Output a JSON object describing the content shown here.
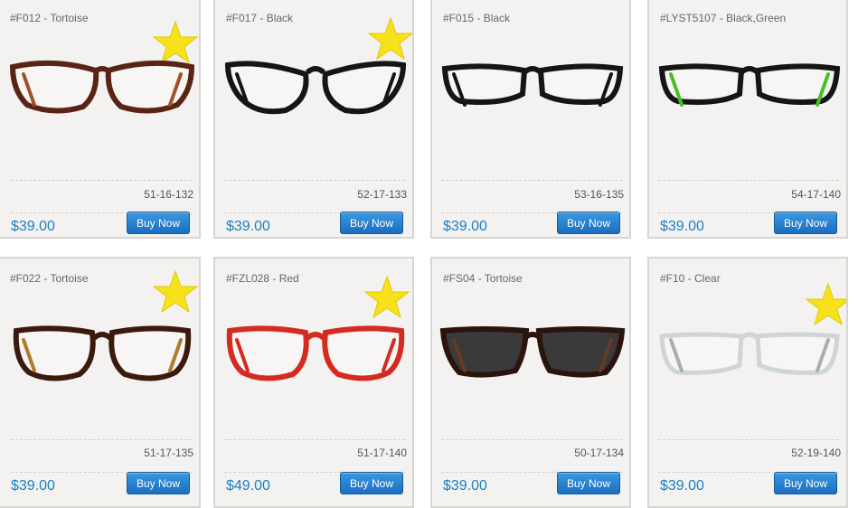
{
  "products": [
    {
      "title": "#F012 - Tortoise",
      "size": "51-16-132",
      "price": "$39.00",
      "buy_label": "Buy Now",
      "featured": true,
      "frame_color": "#5a2414",
      "frame_accent": "#a0502a",
      "lens_color": "none",
      "style": "cat-eye"
    },
    {
      "title": "#F017 - Black",
      "size": "52-17-133",
      "price": "$39.00",
      "buy_label": "Buy Now",
      "featured": true,
      "frame_color": "#151515",
      "frame_accent": "#151515",
      "lens_color": "none",
      "style": "cat-eye-round"
    },
    {
      "title": "#F015 - Black",
      "size": "53-16-135",
      "price": "$39.00",
      "buy_label": "Buy Now",
      "featured": false,
      "frame_color": "#151515",
      "frame_accent": "#151515",
      "lens_color": "none",
      "style": "rect"
    },
    {
      "title": "#LYST5107 - Black,Green",
      "size": "54-17-140",
      "price": "$39.00",
      "buy_label": "Buy Now",
      "featured": false,
      "frame_color": "#151515",
      "frame_accent": "#46c020",
      "lens_color": "none",
      "style": "rect"
    },
    {
      "title": "#F022 - Tortoise",
      "size": "51-17-135",
      "price": "$39.00",
      "buy_label": "Buy Now",
      "featured": true,
      "frame_color": "#3a1a0c",
      "frame_accent": "#b07a2a",
      "lens_color": "none",
      "style": "round"
    },
    {
      "title": "#FZL028 - Red",
      "size": "51-17-140",
      "price": "$49.00",
      "buy_label": "Buy Now",
      "featured": true,
      "frame_color": "#d42a20",
      "frame_accent": "#d42a20",
      "lens_color": "none",
      "style": "round"
    },
    {
      "title": "#FS04 - Tortoise",
      "size": "50-17-134",
      "price": "$39.00",
      "buy_label": "Buy Now",
      "featured": false,
      "frame_color": "#2a140c",
      "frame_accent": "#6a3a20",
      "lens_color": "#3a3a3c",
      "style": "wayfarer"
    },
    {
      "title": "#F10 - Clear",
      "size": "52-19-140",
      "price": "$39.00",
      "buy_label": "Buy Now",
      "featured": true,
      "frame_color": "#cfd4d6",
      "frame_accent": "#a8aeb0",
      "lens_color": "none",
      "style": "rect-clear"
    }
  ],
  "colors": {
    "price": "#1a7fc4",
    "button": "#1c6ebf",
    "star": "#f7e11a",
    "card_bg": "#f3f2f0"
  },
  "icons": {
    "featured": "star-icon"
  }
}
